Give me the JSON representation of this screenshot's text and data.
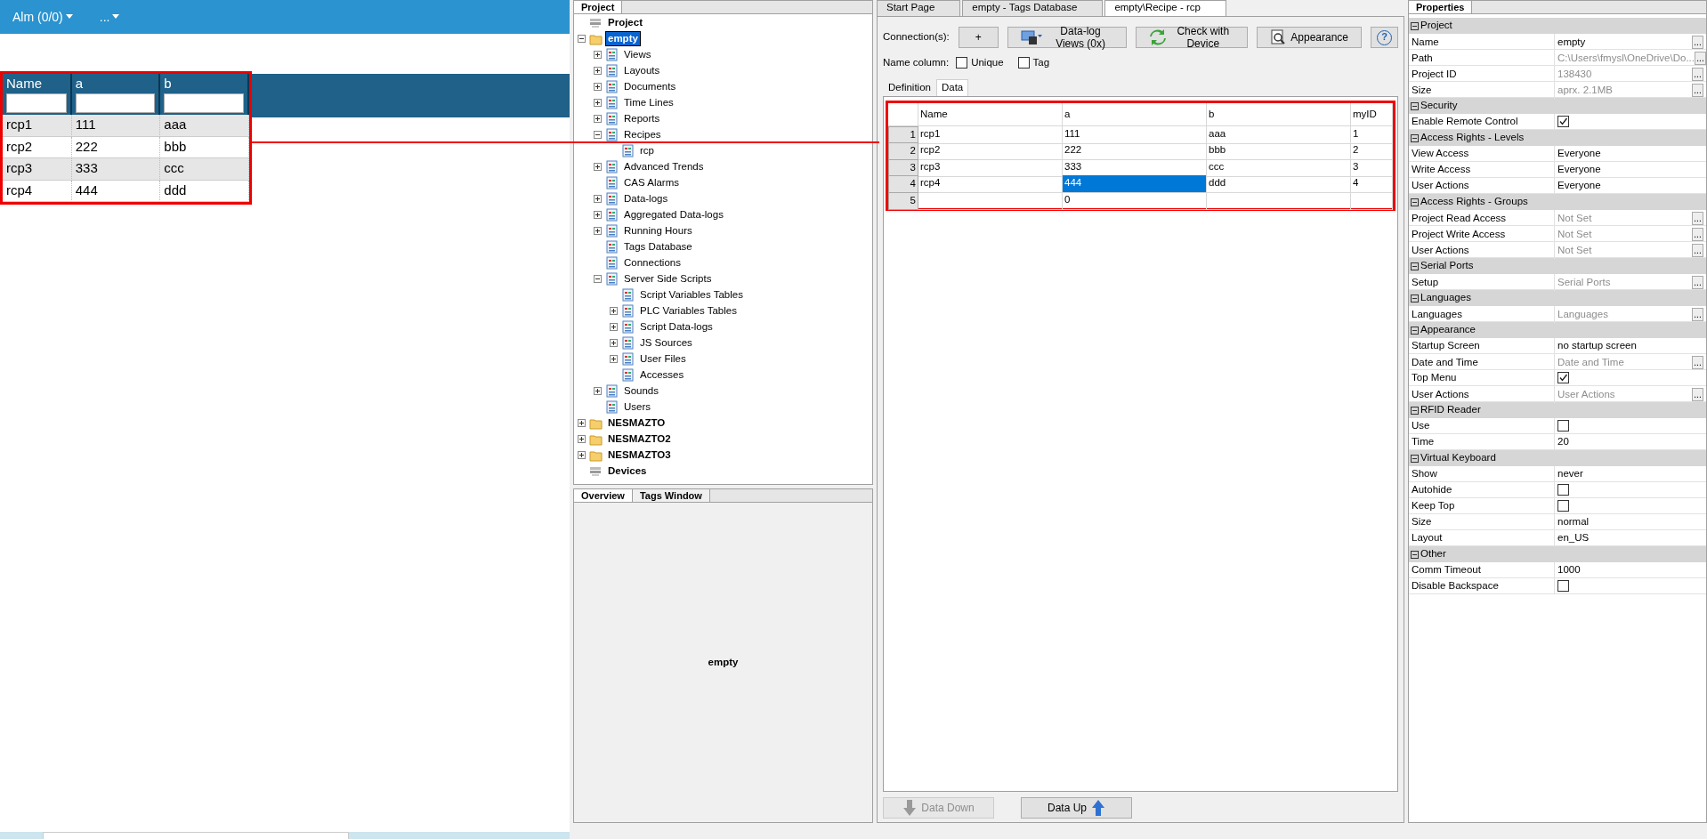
{
  "web": {
    "menu": [
      {
        "label": "Alm (0/0)"
      },
      {
        "label": "..."
      }
    ],
    "table": {
      "columns": [
        "Name",
        "a",
        "b"
      ],
      "rows": [
        [
          "rcp1",
          "111",
          "aaa"
        ],
        [
          "rcp2",
          "222",
          "bbb"
        ],
        [
          "rcp3",
          "333",
          "ccc"
        ],
        [
          "rcp4",
          "444",
          "ddd"
        ]
      ]
    }
  },
  "project_panel": {
    "title": "Project",
    "tree": [
      {
        "label": "Project",
        "kind": "root",
        "selected": false
      },
      {
        "label": "empty",
        "kind": "project",
        "selected": true,
        "expanded": true,
        "children": [
          {
            "label": "Views",
            "kind": "item",
            "selected": false,
            "expanded": false
          },
          {
            "label": "Layouts",
            "kind": "item",
            "selected": false,
            "expanded": false
          },
          {
            "label": "Documents",
            "kind": "item",
            "selected": false,
            "expanded": false
          },
          {
            "label": "Time Lines",
            "kind": "item",
            "selected": false,
            "expanded": false
          },
          {
            "label": "Reports",
            "kind": "item",
            "selected": false,
            "expanded": false
          },
          {
            "label": "Recipes",
            "kind": "item",
            "selected": false,
            "expanded": true,
            "children": [
              {
                "label": "rcp",
                "kind": "item",
                "selected": false
              }
            ]
          },
          {
            "label": "Advanced Trends",
            "kind": "item",
            "selected": false,
            "expanded": false
          },
          {
            "label": "CAS Alarms",
            "kind": "item",
            "selected": false
          },
          {
            "label": "Data-logs",
            "kind": "item",
            "selected": false,
            "expanded": false
          },
          {
            "label": "Aggregated Data-logs",
            "kind": "item",
            "selected": false,
            "expanded": false
          },
          {
            "label": "Running Hours",
            "kind": "item",
            "selected": false,
            "expanded": false
          },
          {
            "label": "Tags Database",
            "kind": "item",
            "selected": false
          },
          {
            "label": "Connections",
            "kind": "item",
            "selected": false
          },
          {
            "label": "Server Side Scripts",
            "kind": "item",
            "selected": false,
            "expanded": true,
            "children": [
              {
                "label": "Script Variables Tables",
                "kind": "item",
                "selected": false
              },
              {
                "label": "PLC Variables Tables",
                "kind": "item",
                "selected": false,
                "expanded": false
              },
              {
                "label": "Script Data-logs",
                "kind": "item",
                "selected": false,
                "expanded": false
              },
              {
                "label": "JS Sources",
                "kind": "item",
                "selected": false,
                "expanded": false
              },
              {
                "label": "User Files",
                "kind": "item",
                "selected": false,
                "expanded": false
              },
              {
                "label": "Accesses",
                "kind": "item",
                "selected": false
              }
            ]
          },
          {
            "label": "Sounds",
            "kind": "item",
            "selected": false,
            "expanded": false
          },
          {
            "label": "Users",
            "kind": "item",
            "selected": false
          }
        ]
      },
      {
        "label": "NESMAZTO",
        "kind": "project",
        "selected": false,
        "expanded": false
      },
      {
        "label": "NESMAZTO2",
        "kind": "project",
        "selected": false,
        "expanded": false
      },
      {
        "label": "NESMAZTO3",
        "kind": "project",
        "selected": false,
        "expanded": false
      },
      {
        "label": "Devices",
        "kind": "root",
        "selected": false
      }
    ]
  },
  "overview_panel": {
    "tabs": [
      {
        "label": "Overview",
        "selected": true
      },
      {
        "label": "Tags Window",
        "selected": false
      }
    ],
    "content": "empty"
  },
  "editor": {
    "tabs": [
      {
        "label": "Start Page",
        "selected": false
      },
      {
        "label": "empty - Tags Database",
        "selected": false
      },
      {
        "label": "empty\\Recipe - rcp",
        "selected": true
      }
    ],
    "connections_label": "Connection(s):",
    "add_button": "+",
    "buttons": [
      {
        "label": "Data-log Views (0x)"
      },
      {
        "label": "Check with Device"
      },
      {
        "label": "Appearance"
      }
    ],
    "help_button": "?",
    "name_column_label": "Name column:",
    "checkboxes": [
      {
        "label": "Unique",
        "checked": false
      },
      {
        "label": "Tag",
        "checked": false
      }
    ],
    "subtabs": [
      {
        "label": "Definition",
        "selected": false
      },
      {
        "label": "Data",
        "selected": true
      }
    ],
    "grid": {
      "columns": [
        "Name",
        "a",
        "b",
        "myID"
      ],
      "rows": [
        {
          "number": "1",
          "cells": [
            {
              "text": "rcp1",
              "selected": false
            },
            {
              "text": "111",
              "selected": false
            },
            {
              "text": "aaa",
              "selected": false
            },
            {
              "text": "1",
              "selected": false
            }
          ]
        },
        {
          "number": "2",
          "cells": [
            {
              "text": "rcp2",
              "selected": false
            },
            {
              "text": "222",
              "selected": false
            },
            {
              "text": "bbb",
              "selected": false
            },
            {
              "text": "2",
              "selected": false
            }
          ]
        },
        {
          "number": "3",
          "cells": [
            {
              "text": "rcp3",
              "selected": false
            },
            {
              "text": "333",
              "selected": false
            },
            {
              "text": "ccc",
              "selected": false
            },
            {
              "text": "3",
              "selected": false
            }
          ]
        },
        {
          "number": "4",
          "cells": [
            {
              "text": "rcp4",
              "selected": false
            },
            {
              "text": "444",
              "selected": true
            },
            {
              "text": "ddd",
              "selected": false
            },
            {
              "text": "4",
              "selected": false
            }
          ]
        },
        {
          "number": "5",
          "cells": [
            {
              "selected": false
            },
            {
              "text": "0",
              "selected": false
            },
            {
              "selected": false
            },
            {
              "selected": false
            }
          ]
        }
      ]
    },
    "bottom_buttons": [
      {
        "label": "Data Down",
        "disabled": true
      },
      {
        "label": "Data Up",
        "disabled": false
      }
    ]
  },
  "properties": {
    "title": "Properties",
    "groups": [
      {
        "title": "Project",
        "expanded": true,
        "rows": [
          {
            "name": "Name",
            "kind": "text",
            "value": "empty",
            "disabled": false,
            "button": "..."
          },
          {
            "name": "Path",
            "kind": "text",
            "value": "C:\\Users\\fmysl\\OneDrive\\Do...",
            "disabled": true,
            "button": "..."
          },
          {
            "name": "Project ID",
            "kind": "text",
            "value": "138430",
            "disabled": true,
            "button": "..."
          },
          {
            "name": "Size",
            "kind": "text",
            "value": "aprx. 2.1MB",
            "disabled": true,
            "button": "..."
          }
        ]
      },
      {
        "title": "Security",
        "expanded": true,
        "rows": [
          {
            "name": "Enable Remote Control",
            "kind": "checkbox",
            "checked": true
          }
        ]
      },
      {
        "title": "Access Rights - Levels",
        "expanded": true,
        "rows": [
          {
            "name": "View Access",
            "kind": "text",
            "value": "Everyone",
            "disabled": false
          },
          {
            "name": "Write Access",
            "kind": "text",
            "value": "Everyone",
            "disabled": false
          },
          {
            "name": "User Actions",
            "kind": "text",
            "value": "Everyone",
            "disabled": false
          }
        ]
      },
      {
        "title": "Access Rights - Groups",
        "expanded": true,
        "rows": [
          {
            "name": "Project Read Access",
            "kind": "text",
            "value": "Not Set",
            "disabled": true,
            "button": "..."
          },
          {
            "name": "Project Write Access",
            "kind": "text",
            "value": "Not Set",
            "disabled": true,
            "button": "..."
          },
          {
            "name": "User Actions",
            "kind": "text",
            "value": "Not Set",
            "disabled": true,
            "button": "..."
          }
        ]
      },
      {
        "title": "Serial Ports",
        "expanded": true,
        "rows": [
          {
            "name": "Setup",
            "kind": "text",
            "value": "Serial Ports",
            "disabled": true,
            "button": "..."
          }
        ]
      },
      {
        "title": "Languages",
        "expanded": true,
        "rows": [
          {
            "name": "Languages",
            "kind": "text",
            "value": "Languages",
            "disabled": true,
            "button": "..."
          }
        ]
      },
      {
        "title": "Appearance",
        "expanded": true,
        "rows": [
          {
            "name": "Startup Screen",
            "kind": "text",
            "value": "no startup screen",
            "disabled": false
          },
          {
            "name": "Date and Time",
            "kind": "text",
            "value": "Date and Time",
            "disabled": true,
            "button": "..."
          },
          {
            "name": "Top Menu",
            "kind": "checkbox",
            "checked": true
          },
          {
            "name": "User Actions",
            "kind": "text",
            "value": "User Actions",
            "disabled": true,
            "button": "..."
          }
        ]
      },
      {
        "title": "RFID Reader",
        "expanded": true,
        "rows": [
          {
            "name": "Use",
            "kind": "checkbox",
            "checked": false
          },
          {
            "name": "Time",
            "kind": "text",
            "value": "20",
            "disabled": false
          }
        ]
      },
      {
        "title": "Virtual Keyboard",
        "expanded": true,
        "rows": [
          {
            "name": "Show",
            "kind": "text",
            "value": "never",
            "disabled": false
          },
          {
            "name": "Autohide",
            "kind": "checkbox",
            "checked": false
          },
          {
            "name": "Keep Top",
            "kind": "checkbox",
            "checked": false
          },
          {
            "name": "Size",
            "kind": "text",
            "value": "normal",
            "disabled": false
          },
          {
            "name": "Layout",
            "kind": "text",
            "value": "en_US",
            "disabled": false
          }
        ]
      },
      {
        "title": "Other",
        "expanded": true,
        "rows": [
          {
            "name": "Comm Timeout",
            "kind": "text",
            "value": "1000",
            "disabled": false
          },
          {
            "name": "Disable Backspace",
            "kind": "checkbox",
            "checked": false
          }
        ]
      }
    ]
  }
}
